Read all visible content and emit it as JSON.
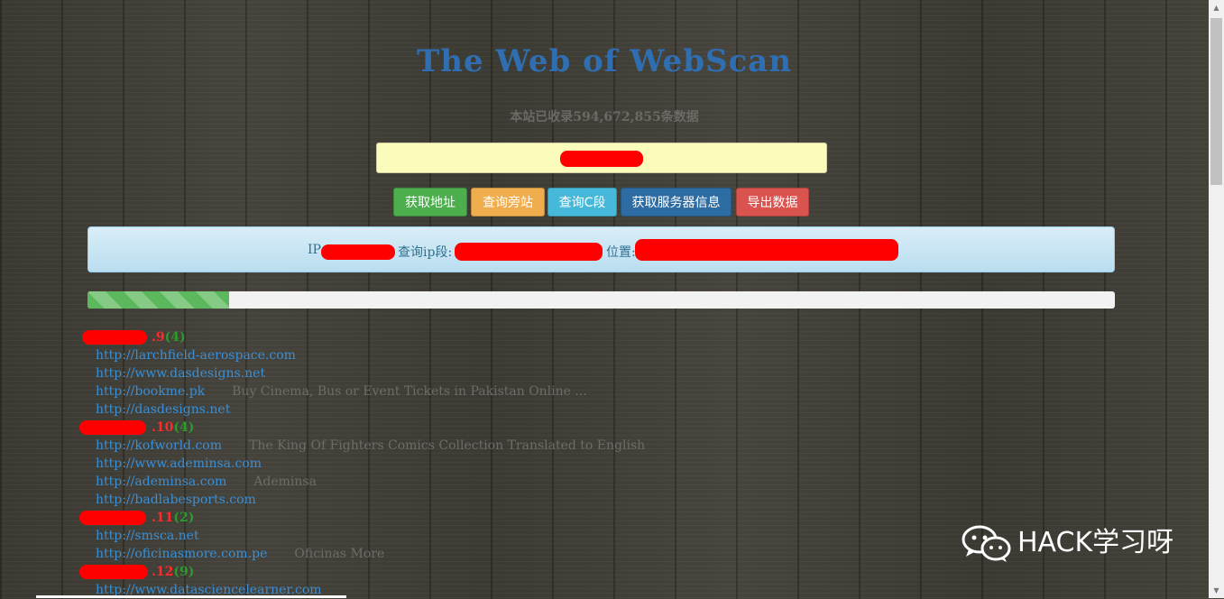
{
  "header": {
    "title": "The Web of WebScan",
    "subtitle": "本站已收录594,672,855条数据"
  },
  "buttons": [
    {
      "label": "获取地址",
      "color": "#4cae4c"
    },
    {
      "label": "查询旁站",
      "color": "#f0ad4e"
    },
    {
      "label": "查询C段",
      "color": "#46b8da"
    },
    {
      "label": "获取服务器信息",
      "color": "#2e6da4"
    },
    {
      "label": "导出数据",
      "color": "#d9534f"
    }
  ],
  "info": {
    "ip_label": "IP",
    "segment_label": "查询ip段:",
    "location_label": "位置:"
  },
  "progress": {
    "fraction": 0.138
  },
  "results": [
    {
      "suffix": ".9",
      "count": "(4)",
      "items": [
        {
          "url": "http://larchfield-aerospace.com",
          "desc": ""
        },
        {
          "url": "http://www.dasdesigns.net",
          "desc": ""
        },
        {
          "url": "http://bookme.pk",
          "desc": "Buy Cinema, Bus or Event Tickets in Pakistan Online ..."
        },
        {
          "url": "http://dasdesigns.net",
          "desc": ""
        }
      ]
    },
    {
      "suffix": ".10",
      "count": "(4)",
      "items": [
        {
          "url": "http://kofworld.com",
          "desc": "The King Of Fighters Comics Collection Translated to English"
        },
        {
          "url": "http://www.ademinsa.com",
          "desc": ""
        },
        {
          "url": "http://ademinsa.com",
          "desc": "Ademinsa"
        },
        {
          "url": "http://badlabesports.com",
          "desc": ""
        }
      ]
    },
    {
      "suffix": ".11",
      "count": "(2)",
      "items": [
        {
          "url": "http://smsca.net",
          "desc": ""
        },
        {
          "url": "http://oficinasmore.com.pe",
          "desc": "Oficinas More"
        }
      ]
    },
    {
      "suffix": ".12",
      "count": "(9)",
      "items": [
        {
          "url": "http://www.datasciencelearner.com",
          "desc": ""
        }
      ]
    }
  ],
  "watermark": {
    "text": "HACK学习呀",
    "icon": "wechat-icon"
  }
}
